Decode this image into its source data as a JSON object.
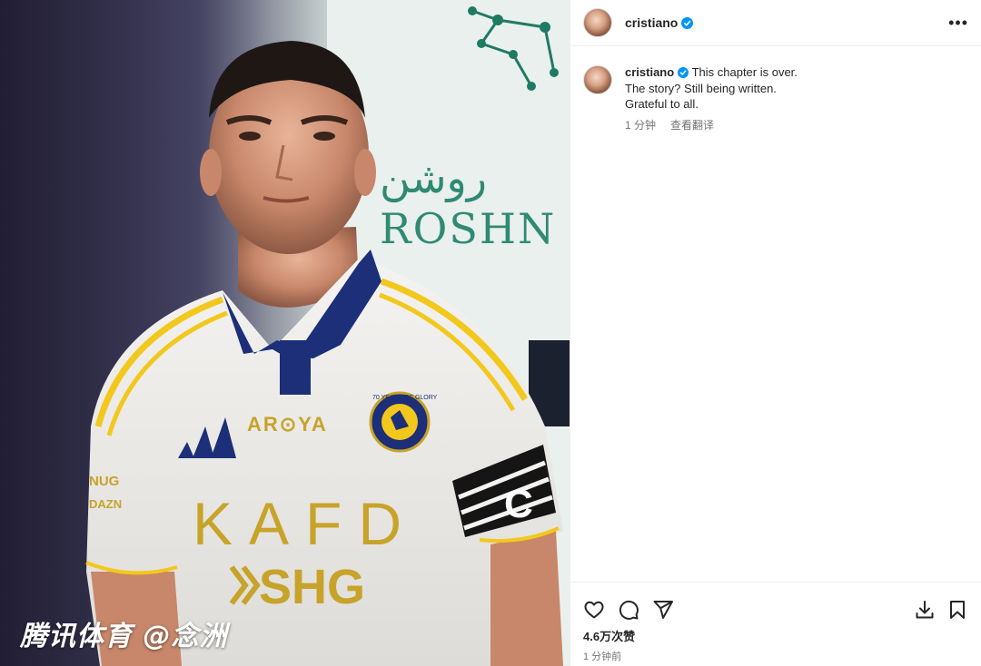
{
  "photo": {
    "watermark": "腾讯体育 @念洲",
    "sponsor_top": "AR⊙YA",
    "sponsor_main": "KAFD",
    "sponsor_bottom": "SHG",
    "bg_sign_latin": "ROSHN G",
    "bg_sign_arabic": "روشن",
    "crest_text": "70 YEARS OF GLORY"
  },
  "post": {
    "username": "cristiano",
    "caption": {
      "line1": "This chapter is over.",
      "line2": "The story? Still being written.",
      "line3": "Grateful to all."
    },
    "caption_time": "1 分钟",
    "translate_label": "查看翻译",
    "likes": "4.6万次赞",
    "posted_time": "1 分钟前",
    "more_label": "•••"
  },
  "icons": {
    "verified": "verified-badge-icon",
    "like": "heart-icon",
    "comment": "comment-icon",
    "share": "share-icon",
    "download": "download-icon",
    "save": "bookmark-icon"
  },
  "colors": {
    "verified": "#0095f6",
    "text": "#262626",
    "secondary": "#737373",
    "divider": "#efefef"
  }
}
